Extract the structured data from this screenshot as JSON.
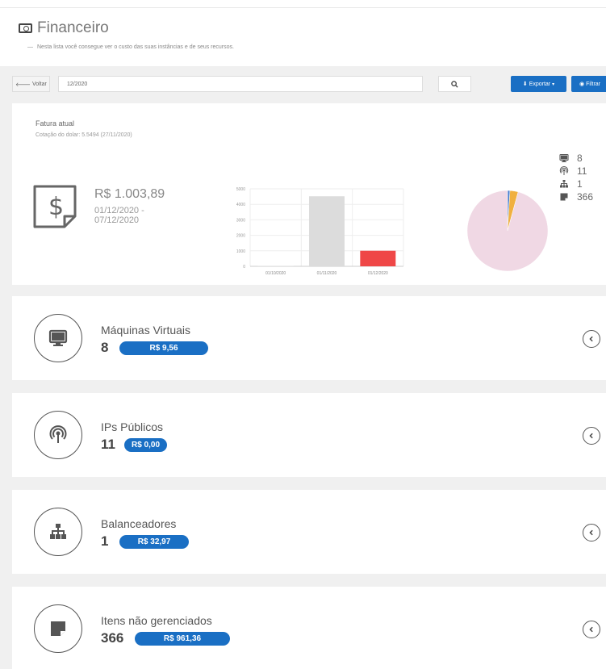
{
  "header": {
    "title": "Financeiro",
    "subtitle": "Nesta lista você consegue ver o custo das suas instâncias e de seus recursos.",
    "dash": "—"
  },
  "toolbar": {
    "back_label": "Voltar",
    "period_value": "12/2020",
    "export_label": "Exportar",
    "filter_label": "Filtrar"
  },
  "summary": {
    "title": "Fatura atual",
    "exchange": "Cotação do dolar: 5.5494 (27/11/2020)",
    "total": "R$ 1.003,89",
    "period": "01/12/2020 - 07/12/2020"
  },
  "chart_data": [
    {
      "type": "bar",
      "categories": [
        "01/10/2020",
        "01/11/2020",
        "01/12/2020"
      ],
      "values": [
        20,
        4520,
        1004
      ],
      "colors": [
        "#dcdcdc",
        "#dcdcdc",
        "#ef4747"
      ],
      "ylim": [
        0,
        5000
      ],
      "yticks": [
        0,
        1000,
        2000,
        3000,
        4000,
        5000
      ],
      "grid": true
    },
    {
      "type": "pie",
      "values": [
        0.95,
        3.29,
        0.0,
        95.76
      ],
      "colors": [
        "#4a7fd0",
        "#f0b040",
        "#e8e8e8",
        "#f0d8e4"
      ]
    }
  ],
  "legend": [
    {
      "icon": "monitor-icon",
      "value": "8"
    },
    {
      "icon": "broadcast-icon",
      "value": "11"
    },
    {
      "icon": "sitemap-icon",
      "value": "1"
    },
    {
      "icon": "note-icon",
      "value": "366"
    }
  ],
  "resources": [
    {
      "name": "Máquinas Virtuais",
      "count": "8",
      "cost": "R$ 9,56",
      "icon": "monitor-icon"
    },
    {
      "name": "IPs Públicos",
      "count": "11",
      "cost": "R$ 0,00",
      "icon": "broadcast-icon"
    },
    {
      "name": "Balanceadores",
      "count": "1",
      "cost": "R$ 32,97",
      "icon": "sitemap-icon"
    },
    {
      "name": "Itens não gerenciados",
      "count": "366",
      "cost": "R$ 961,36",
      "icon": "note-icon"
    }
  ],
  "colors": {
    "accent": "#1a6fc4",
    "bar_current": "#ef4747",
    "bar_past": "#dcdcdc"
  }
}
